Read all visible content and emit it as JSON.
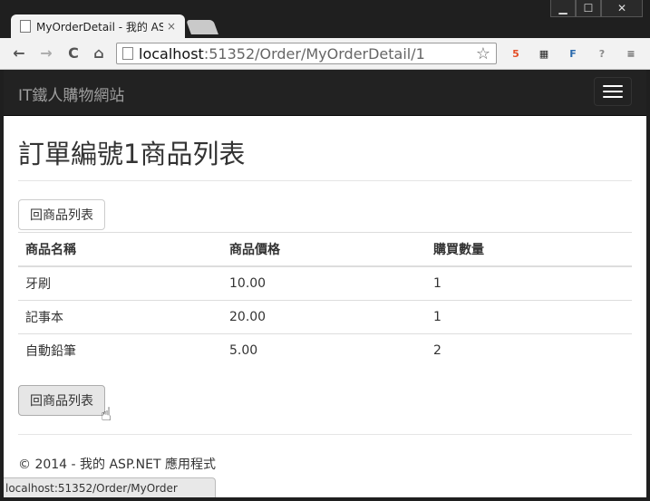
{
  "browser": {
    "tab_title": "MyOrderDetail - 我的 ASP",
    "tab_close": "×",
    "url_host": "localhost",
    "url_path": ":51352/Order/MyOrderDetail/1",
    "status_url": "localhost:51352/Order/MyOrder",
    "controls": {
      "minimize": "▁",
      "maximize": "☐",
      "close": "✕"
    },
    "nav_icons": {
      "back": "←",
      "forward": "→",
      "reload": "C",
      "home": "⌂"
    },
    "star": "☆",
    "extensions": [
      {
        "name": "html5-extension-icon",
        "glyph": "5",
        "color": "#e44d26"
      },
      {
        "name": "qr-code-icon",
        "glyph": "▦",
        "color": "#222222"
      },
      {
        "name": "f-extension-icon",
        "glyph": "F",
        "color": "#2a6aad"
      },
      {
        "name": "help-icon",
        "glyph": "?",
        "color": "#8a8a8a"
      },
      {
        "name": "menu-icon",
        "glyph": "≡",
        "color": "#555555"
      }
    ]
  },
  "site": {
    "brand": "IT鐵人購物網站"
  },
  "page": {
    "title": "訂單編號1商品列表",
    "back_button_label": "回商品列表",
    "table": {
      "headers": [
        "商品名稱",
        "商品價格",
        "購買數量"
      ],
      "rows": [
        [
          "牙刷",
          "10.00",
          "1"
        ],
        [
          "記事本",
          "20.00",
          "1"
        ],
        [
          "自動鉛筆",
          "5.00",
          "2"
        ]
      ]
    },
    "footer": "© 2014 - 我的 ASP.NET 應用程式"
  }
}
